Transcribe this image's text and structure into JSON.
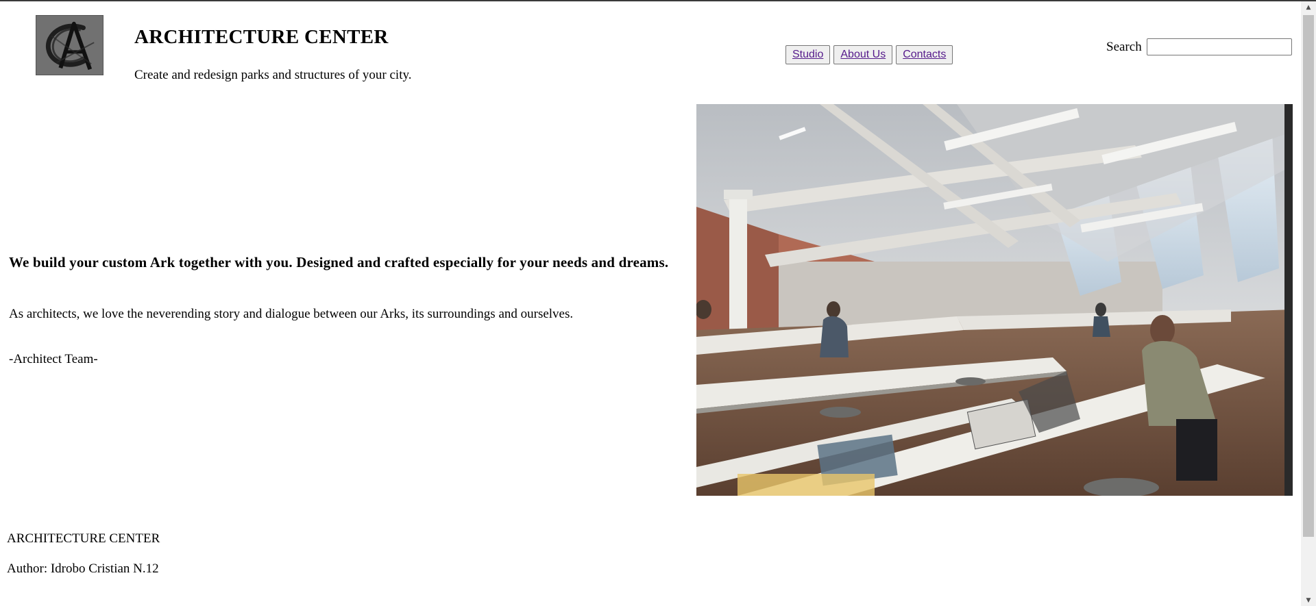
{
  "header": {
    "title": "ARCHITECTURE CENTER",
    "tagline": "Create and redesign parks and structures of your city.",
    "logo_icon": "architecture-center-logo"
  },
  "nav": {
    "items": [
      {
        "label": "Studio"
      },
      {
        "label": "About Us"
      },
      {
        "label": "Contacts"
      }
    ]
  },
  "search": {
    "label": "Search",
    "value": "",
    "placeholder": ""
  },
  "main": {
    "headline": "We build your custom Ark together with you. Designed and crafted especially for your needs and dreams.",
    "intro": "As architects, we love the neverending story and dialogue between our Arks, its surroundings and ourselves.",
    "signature": "-Architect Team-",
    "photo_icon": "architecture-studio-photo"
  },
  "footer": {
    "title": "ARCHITECTURE CENTER",
    "author": "Author: Idrobo Cristian N.12"
  },
  "colors": {
    "link": "#551a8b",
    "button_bg": "#efefef",
    "button_border": "#767676",
    "scrollbar_track": "#f1f1f1",
    "scrollbar_thumb": "#c1c1c1"
  }
}
